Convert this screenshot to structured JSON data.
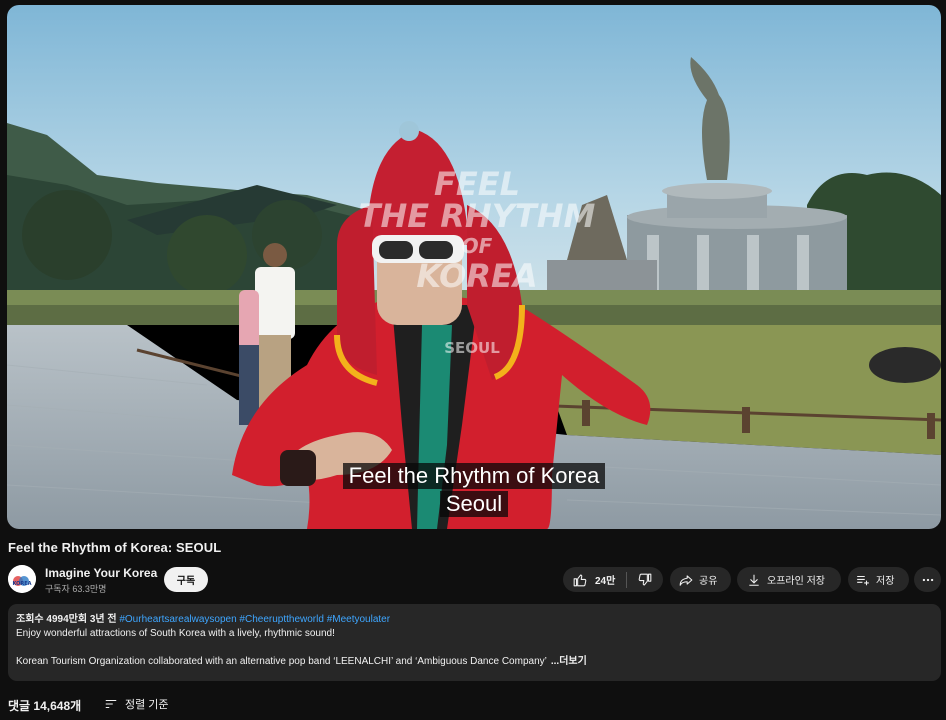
{
  "video": {
    "overlay_text": [
      "FEEL",
      "THE RHYTHM",
      "OF",
      "KOREA",
      "SEOUL"
    ],
    "captions": [
      "Feel the Rhythm of Korea",
      "Seoul"
    ]
  },
  "title": "Feel the Rhythm of Korea: SEOUL",
  "channel": {
    "name": "Imagine Your Korea",
    "subscribers": "구독자 63.3만명",
    "avatar_text": "KOREA",
    "subscribe_label": "구독"
  },
  "actions": {
    "like_count": "24만",
    "share_label": "공유",
    "download_label": "오프라인 저장",
    "save_label": "저장"
  },
  "description": {
    "views": "조회수 4994만회",
    "age": "3년 전",
    "hashtags": "#Ourheartsarealwaysopen #Cheerupttheworld #Meetyoulater",
    "line1": "Enjoy wonderful attractions of South Korea with a lively, rhythmic sound!",
    "line2": "Korean Tourism Organization collaborated with an alternative pop band ‘LEENALCHI’ and ‘Ambiguous Dance Company’",
    "more_label": "...더보기"
  },
  "comments": {
    "count_label": "댓글 14,648개",
    "sort_label": "정렬 기준"
  },
  "colors": {
    "background": "#0f0f0f",
    "surface": "#272727",
    "link": "#3ea6ff",
    "text": "#f1f1f1",
    "muted": "#aaaaaa"
  },
  "icons": [
    "thumbs-up-icon",
    "thumbs-down-icon",
    "share-icon",
    "download-icon",
    "playlist-add-icon",
    "more-vert-icon",
    "sort-icon"
  ]
}
